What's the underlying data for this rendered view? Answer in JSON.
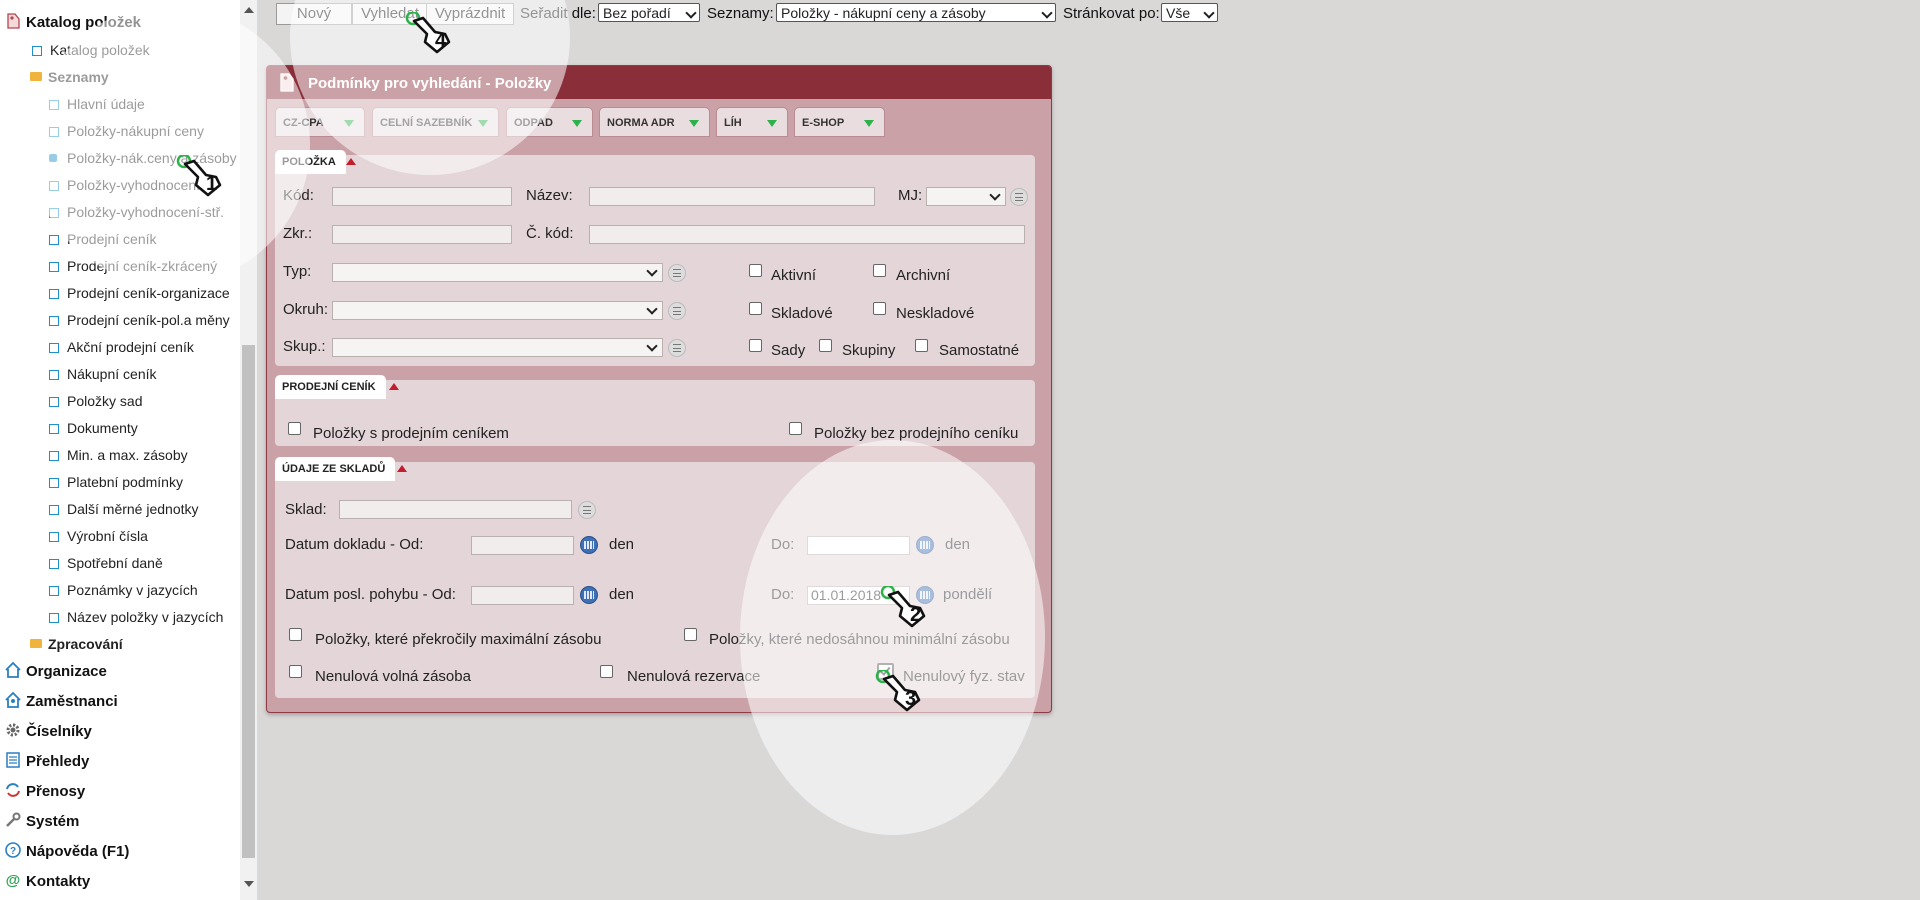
{
  "sidebar": {
    "root": {
      "label": "Katalog položek"
    },
    "items": [
      {
        "label": "Katalog položek",
        "selected": false
      },
      {
        "label": "Seznamy",
        "folder": true
      },
      {
        "label": "Hlavní údaje"
      },
      {
        "label": "Položky-nákupní ceny"
      },
      {
        "label": "Položky-nák.ceny a zásoby",
        "selected": true
      },
      {
        "label": "Položky-vyhodnocení"
      },
      {
        "label": "Položky-vyhodnocení-stř."
      },
      {
        "label": "Prodejní ceník"
      },
      {
        "label": "Prodejní ceník-zkrácený"
      },
      {
        "label": "Prodejní ceník-organizace"
      },
      {
        "label": "Prodejní ceník-pol.a měny"
      },
      {
        "label": "Akční prodejní ceník"
      },
      {
        "label": "Nákupní ceník"
      },
      {
        "label": "Položky sad"
      },
      {
        "label": "Dokumenty"
      },
      {
        "label": "Min. a max. zásoby"
      },
      {
        "label": "Platební podmínky"
      },
      {
        "label": "Další měrné jednotky"
      },
      {
        "label": "Výrobní čísla"
      },
      {
        "label": "Spotřební daně"
      },
      {
        "label": "Poznámky v jazycích"
      },
      {
        "label": "Název položky v jazycích"
      },
      {
        "label": "Zpracování",
        "folder": true
      }
    ],
    "modules": [
      {
        "label": "Organizace",
        "icon": "house-icon"
      },
      {
        "label": "Zaměstnanci",
        "icon": "house-person-icon"
      },
      {
        "label": "Číselníky",
        "icon": "gear-icon"
      },
      {
        "label": "Přehledy",
        "icon": "list-icon"
      },
      {
        "label": "Přenosy",
        "icon": "sync-icon"
      },
      {
        "label": "Systém",
        "icon": "wrench-icon"
      },
      {
        "label": "Nápověda (F1)",
        "icon": "help-icon"
      },
      {
        "label": "Kontakty",
        "icon": "at-icon"
      }
    ]
  },
  "toolbar": {
    "new_label": "Nový",
    "search_label": "Vyhledat",
    "clear_label": "Vyprázdnit",
    "sort_label": "Seřadit dle:",
    "sort_value": "Bez pořadí",
    "lists_label": "Seznamy:",
    "lists_value": "Položky - nákupní ceny a zásoby",
    "paging_label": "Stránkovat po:",
    "paging_value": "Vše"
  },
  "dialog": {
    "title": "Podmínky pro vyhledání - Položky",
    "tabs": [
      "CZ-CPA",
      "CELNÍ SAZEBNÍK",
      "ODPAD",
      "NORMA ADR",
      "LÍH",
      "E-SHOP"
    ],
    "item_section": {
      "title": "POLOŽKA",
      "code_label": "Kód:",
      "name_label": "Název:",
      "unit_label": "MJ:",
      "abbr_label": "Zkr.:",
      "ccode_label": "Č. kód:",
      "type_label": "Typ:",
      "scope_label": "Okruh:",
      "group_label": "Skup.:",
      "active_label": "Aktivní",
      "archive_label": "Archivní",
      "stock_label": "Skladové",
      "nonstock_label": "Neskladové",
      "sets_label": "Sady",
      "groups_label": "Skupiny",
      "standalone_label": "Samostatné"
    },
    "price_section": {
      "title": "PRODEJNÍ CENÍK",
      "with_label": "Položky s prodejním ceníkem",
      "without_label": "Položky bez prodejního ceníku"
    },
    "stock_section": {
      "title": "ÚDAJE ZE SKLADŮ",
      "warehouse_label": "Sklad:",
      "docdate_label": "Datum dokladu - Od:",
      "den1": "den",
      "to1_label": "Do:",
      "den2": "den",
      "lastmove_label": "Datum posl. pohybu - Od:",
      "den3": "den",
      "to2_label": "Do:",
      "to2_value": "01.01.2018",
      "weekday": "pondělí",
      "exceed_label": "Položky, které překročily maximální zásobu",
      "below_label": "Položky, které nedosáhnou minimální zásobu",
      "nonzero_free_label": "Nenulová volná zásoba",
      "nonzero_res_label": "Nenulová rezervace",
      "nonzero_phys_label": "Nenulový fyz. stav"
    }
  },
  "hints": [
    "1",
    "2",
    "3",
    "4"
  ]
}
